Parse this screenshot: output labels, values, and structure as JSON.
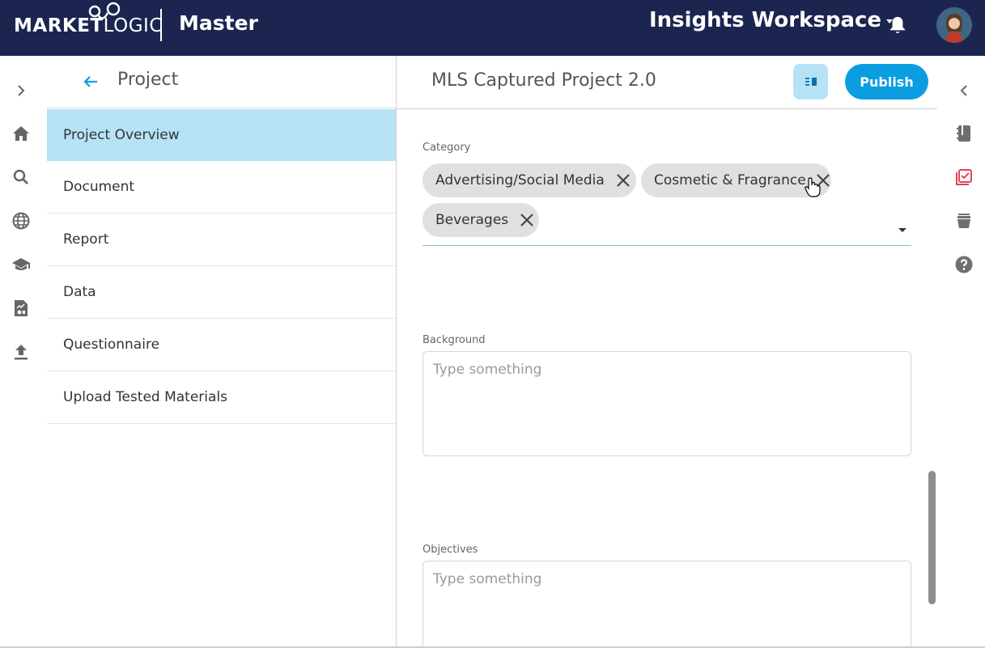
{
  "brand": {
    "logo_market": "MARKET",
    "logo_logic": "LOGIC",
    "app_name": "Master"
  },
  "header": {
    "workspace": "Insights Workspace"
  },
  "nav": {
    "title": "Project",
    "items": [
      {
        "label": "Project Overview",
        "active": true
      },
      {
        "label": "Document"
      },
      {
        "label": "Report"
      },
      {
        "label": "Data"
      },
      {
        "label": "Questionnaire"
      },
      {
        "label": "Upload Tested Materials"
      }
    ]
  },
  "main": {
    "title": "MLS Captured Project 2.0",
    "publish_label": "Publish",
    "category": {
      "label": "Category",
      "chips": [
        "Advertising/Social Media",
        "Cosmetic & Fragrance",
        "Beverages"
      ]
    },
    "background": {
      "label": "Background",
      "placeholder": "Type something"
    },
    "objectives": {
      "label": "Objectives",
      "placeholder": "Type something"
    }
  },
  "colors": {
    "topbar": "#1b2550",
    "accent": "#0a9ee0",
    "active_nav": "#b6e2f6",
    "checklist_icon": "#e0435a"
  },
  "icons": {
    "left_rail": [
      "chevron-right-icon",
      "home-icon",
      "search-icon",
      "globe-icon",
      "graduation-cap-icon",
      "report-icon",
      "upload-icon"
    ],
    "right_rail": [
      "chevron-left-icon",
      "notebook-icon",
      "checklist-icon",
      "archive-icon",
      "help-icon"
    ]
  }
}
